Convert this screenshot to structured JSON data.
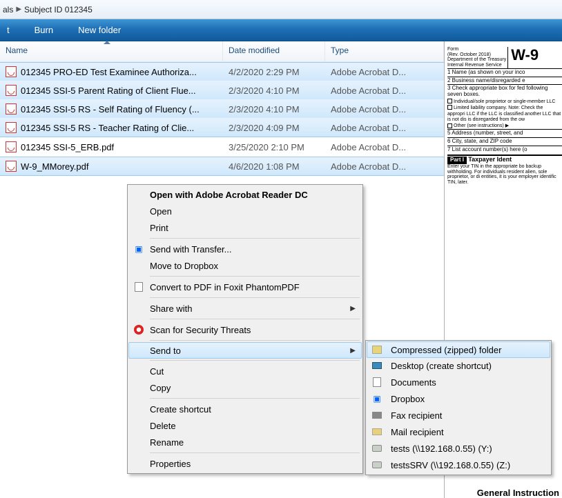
{
  "breadcrumb": {
    "part1": "als",
    "part2": "Subject ID 012345"
  },
  "toolbar": {
    "btn1": "t",
    "btn2": "Burn",
    "btn3": "New folder"
  },
  "columns": {
    "name": "Name",
    "date": "Date modified",
    "type": "Type"
  },
  "files": [
    {
      "name": "012345 PRO-ED Test Examinee Authoriza...",
      "date": "4/2/2020 2:29 PM",
      "type": "Adobe Acrobat D...",
      "sel": true
    },
    {
      "name": "012345 SSI-5 Parent Rating of Client Flue...",
      "date": "2/3/2020 4:10 PM",
      "type": "Adobe Acrobat D...",
      "sel": true
    },
    {
      "name": "012345 SSI-5 RS - Self Rating of Fluency (...",
      "date": "2/3/2020 4:10 PM",
      "type": "Adobe Acrobat D...",
      "sel": true
    },
    {
      "name": "012345 SSI-5 RS - Teacher Rating of Clie...",
      "date": "2/3/2020 4:09 PM",
      "type": "Adobe Acrobat D...",
      "sel": true
    },
    {
      "name": "012345 SSI-5_ERB.pdf",
      "date": "3/25/2020 2:10 PM",
      "type": "Adobe Acrobat D...",
      "sel": false
    },
    {
      "name": "W-9_MMorey.pdf",
      "date": "4/6/2020 1:08 PM",
      "type": "Adobe Acrobat D...",
      "sel": true
    }
  ],
  "ctx": {
    "open_default": "Open with Adobe Acrobat Reader DC",
    "open": "Open",
    "print": "Print",
    "transfer": "Send with Transfer...",
    "dropbox_move": "Move to Dropbox",
    "foxit": "Convert to PDF in Foxit PhantomPDF",
    "share": "Share with",
    "scan": "Scan for Security Threats",
    "sendto": "Send to",
    "cut": "Cut",
    "copy": "Copy",
    "shortcut": "Create shortcut",
    "delete": "Delete",
    "rename": "Rename",
    "props": "Properties"
  },
  "sendto": {
    "zip": "Compressed (zipped) folder",
    "desk": "Desktop (create shortcut)",
    "docs": "Documents",
    "dbox": "Dropbox",
    "fax": "Fax recipient",
    "mail": "Mail recipient",
    "d1": "tests (\\\\192.168.0.55) (Y:)",
    "d2": "testsSRV (\\\\192.168.0.55) (Z:)"
  },
  "preview": {
    "form": "Form",
    "title": "W-9",
    "rev": "(Rev. October 2018)",
    "dept": "Department of the Treasury",
    "irs": "Internal Revenue Service",
    "l1": "1  Name (as shown on your inco",
    "l2": "2  Business name/disregarded e",
    "l3": "3  Check appropriate box for fed following seven boxes.",
    "c1": "Individual/sole proprietor or single-member LLC",
    "c2": "Limited liability company. Note: Check the appropri LLC if the LLC is classified another LLC that is not dis is disregarded from the ow",
    "c3": "Other (see instructions) ▶",
    "l5": "5  Address (number, street, and",
    "l6": "6  City, state, and ZIP code",
    "l7": "7  List account number(s) here (o",
    "part1": "Part I",
    "part1t": "Taxpayer Ident",
    "p1text": "Enter your TIN in the appropriate bo backup withholding. For individuals resident alien, sole proprietor, or di entities, it is your employer identific",
    "tin": "TIN, later.",
    "gi": "General Instruction"
  }
}
